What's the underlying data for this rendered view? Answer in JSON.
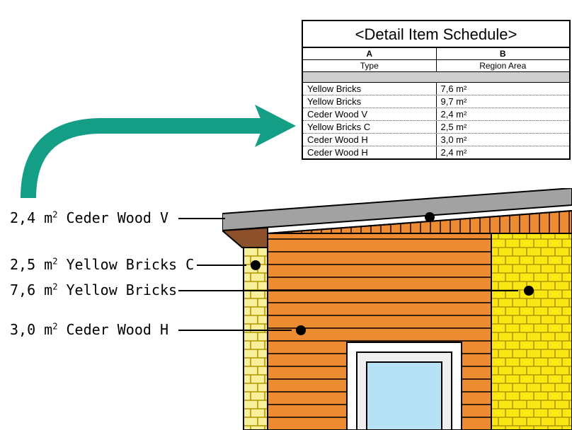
{
  "schedule": {
    "title": "<Detail Item Schedule>",
    "col_a": "A",
    "col_b": "B",
    "header_type": "Type",
    "header_area": "Region Area",
    "rows": [
      {
        "type": "Yellow Bricks",
        "area": "7,6 m²"
      },
      {
        "type": "Yellow Bricks",
        "area": "9,7 m²"
      },
      {
        "type": "Ceder Wood V",
        "area": "2,4 m²"
      },
      {
        "type": "Yellow Bricks C",
        "area": "2,5 m²"
      },
      {
        "type": "Ceder Wood H",
        "area": "3,0 m²"
      },
      {
        "type": "Ceder Wood H",
        "area": "2,4 m²"
      }
    ]
  },
  "labels": {
    "l1_area": "2,4 m",
    "l1_name": "Ceder Wood V",
    "l2_area": "2,5 m",
    "l2_name": "Yellow Bricks C",
    "l3_area": "7,6 m",
    "l3_name": "Yellow Bricks",
    "l4_area": "3,0 m",
    "l4_name": "Ceder Wood H",
    "sup2": "2"
  },
  "colors": {
    "arrow": "#149e85",
    "brick_yellow_line": "#b29500",
    "brick_yellow_fill": "#f8f09a",
    "brick_yellow2_fill": "#fbe813",
    "ceder_fill": "#ed8b33",
    "ceder_line": "#a35512",
    "roof_gray": "#a2a2a2",
    "trim_brown": "#8c502a",
    "window_blue": "#b7e2f6"
  },
  "chart_data": {
    "type": "table",
    "title": "<Detail Item Schedule>",
    "columns": [
      "Type",
      "Region Area (m²)"
    ],
    "rows": [
      [
        "Yellow Bricks",
        7.6
      ],
      [
        "Yellow Bricks",
        9.7
      ],
      [
        "Ceder Wood V",
        2.4
      ],
      [
        "Yellow Bricks C",
        2.5
      ],
      [
        "Ceder Wood H",
        3.0
      ],
      [
        "Ceder Wood H",
        2.4
      ]
    ]
  }
}
